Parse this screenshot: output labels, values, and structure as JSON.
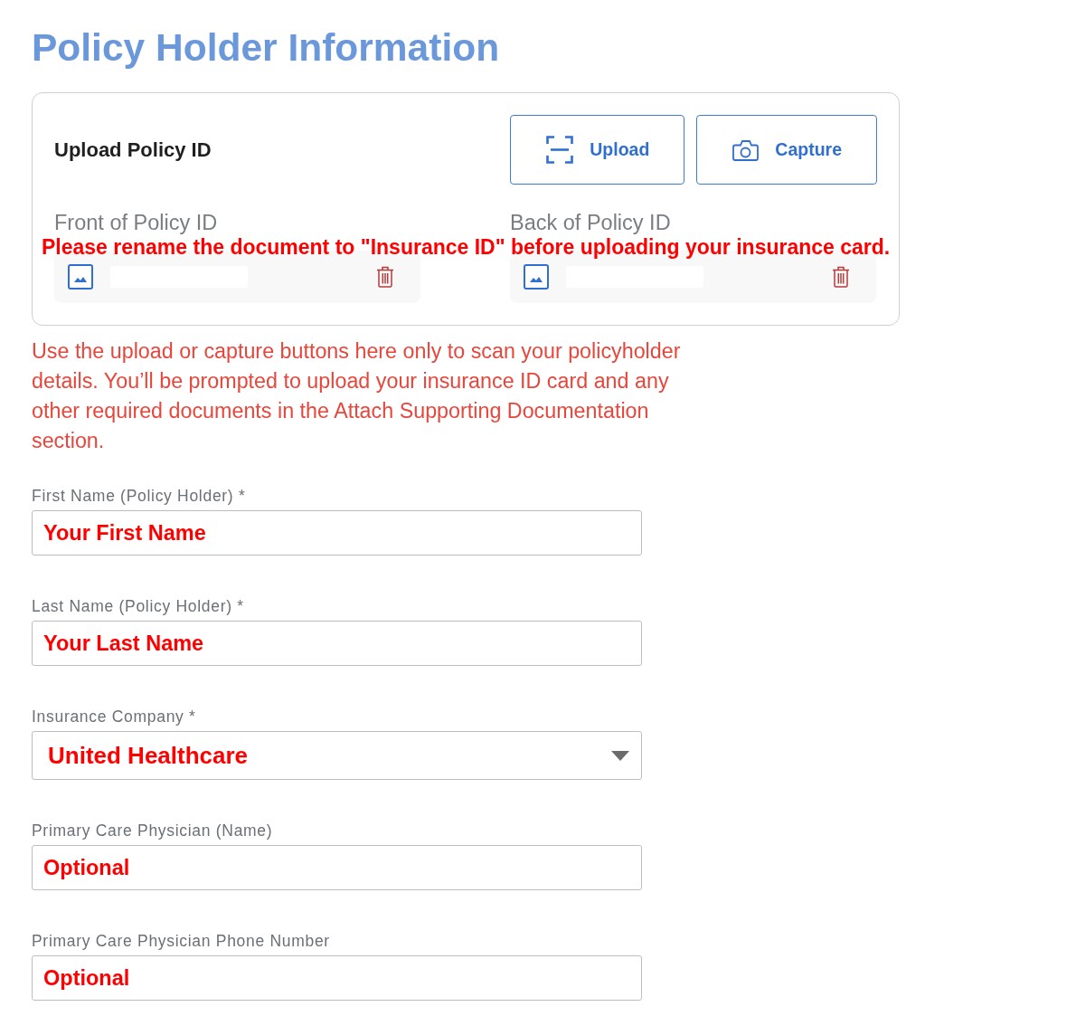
{
  "page_title": "Policy Holder Information",
  "upload_card": {
    "title": "Upload Policy ID",
    "buttons": [
      {
        "label": "Upload",
        "kind": "scan"
      },
      {
        "label": "Capture",
        "kind": "camera"
      }
    ],
    "sides": [
      {
        "label": "Front of Policy ID"
      },
      {
        "label": "Back of Policy ID"
      }
    ],
    "notice": "Please rename the document to \"Insurance ID\" before uploading your insurance card."
  },
  "instructions": "Use the upload or capture buttons here only to scan your policyholder details. You’ll be prompted to upload your insurance ID card and any other required documents in the Attach Supporting Documentation section.",
  "fields": [
    {
      "label": "First Name (Policy Holder) *",
      "kind": "text",
      "value": "Your First Name"
    },
    {
      "label": "Last Name (Policy Holder) *",
      "kind": "text",
      "value": "Your Last Name"
    },
    {
      "label": "Insurance Company *",
      "kind": "dropdown",
      "value": "United Healthcare"
    },
    {
      "label": "Primary Care Physician (Name)",
      "kind": "text",
      "value": "Optional"
    },
    {
      "label": "Primary Care Physician Phone Number",
      "kind": "text",
      "value": "Optional"
    }
  ]
}
